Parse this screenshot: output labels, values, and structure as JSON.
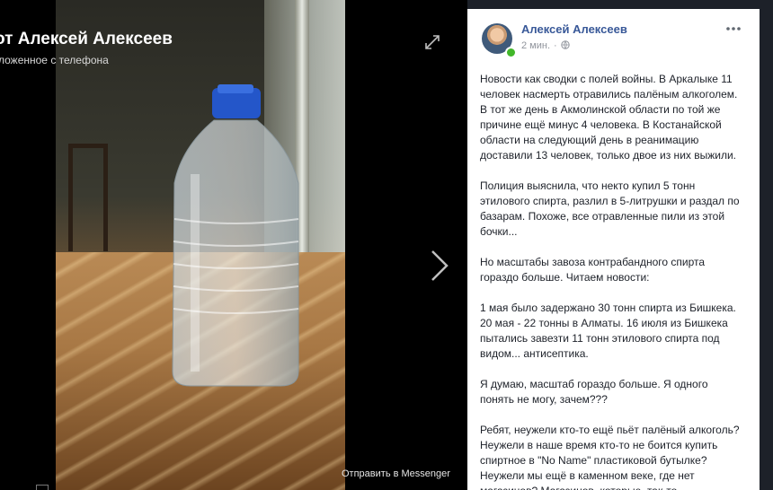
{
  "viewer": {
    "title": "от Алексей Алексеев",
    "subtitle": "ложенное с телефона",
    "messenger_label": "Отправить в Messenger"
  },
  "post": {
    "author": "Алексей Алексеев",
    "time": "2 мин.",
    "paragraphs": [
      "Новости как сводки с полей войны. В Аркалыке 11 человек насмерть отравились палёным алкоголем. В тот же день в Акмолинской области по той же причине ещё минус 4 человека. В Костанайской области на следующий день в реанимацию доставили 13 человек, только двое из них выжили.",
      "Полиция выяснила, что некто купил 5 тонн этилового спирта, разлил в 5-литрушки и раздал по базарам. Похоже, все отравленные пили из этой бочки...",
      "Но масштабы завоза контрабандного спирта гораздо больше. Читаем новости:",
      "1 мая было задержано 30 тонн спирта из Бишкека. 20 мая - 22 тонны в Алматы. 16 июля из Бишкека пытались завезти 11 тонн этилового спирта под видом... антисептика.",
      "Я думаю, масштаб гораздо больше. Я одного понять не могу, зачем???",
      "Ребят, неужели кто-то ещё пьёт палёный алкоголь? Неужели в наше время кто-то не боится купить спиртное в \"No Name\" пластиковой бутылке? Неужели мы ещё в каменном веке, где нет магазинов? Магазинов, которые, так-то"
    ]
  },
  "icons": {
    "expand": "expand-icon",
    "next": "chevron-right-icon",
    "more": "more-options-icon",
    "globe": "globe-icon"
  },
  "colors": {
    "author_link": "#385898",
    "online": "#42b72a",
    "meta_gray": "#90949c"
  }
}
